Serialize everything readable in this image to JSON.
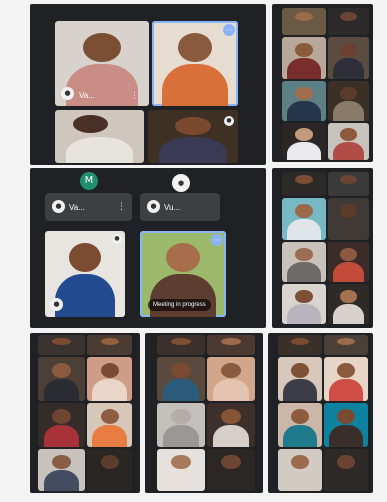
{
  "panel1": {
    "tiles": [
      {
        "name": "Va..."
      },
      {
        "name": ""
      },
      {
        "name": ""
      },
      {
        "name": ""
      }
    ],
    "pinned_icon": "pin-icon"
  },
  "panel3": {
    "cards": [
      {
        "avatar": "M",
        "name": "Va..."
      },
      {
        "name": "Vu..."
      }
    ],
    "presenting_label": "Meeting in progress"
  },
  "colors": {
    "panel_bg": "#202124",
    "card_bg": "#3c4043",
    "accent": "#8ab4f8",
    "avatar_green": "#1e8e6e"
  }
}
